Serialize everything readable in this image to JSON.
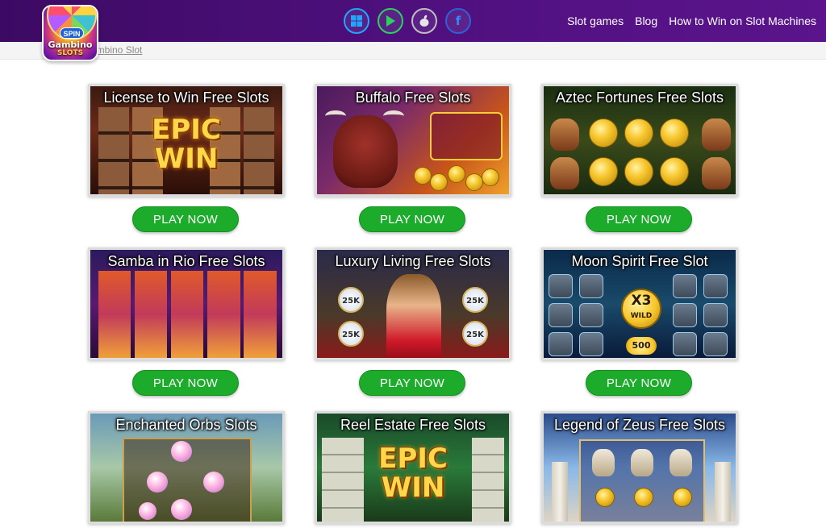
{
  "header": {
    "logo": {
      "line1": "Gambino",
      "line2": "SLOTS",
      "spin": "SPIN"
    },
    "store_icons": [
      "windows-icon",
      "google-play-icon",
      "apple-icon",
      "facebook-icon"
    ],
    "facebook_glyph": "f",
    "nav": [
      "Slot games",
      "Blog",
      "How to Win on Slot Machines"
    ]
  },
  "breadcrumb": "ambino Slot",
  "colors": {
    "header_bg": "#4f107e",
    "play_button": "#1dab2c",
    "tile_border": "#dcdcdc"
  },
  "play_label": "PLAY NOW",
  "games": [
    {
      "title": "License to Win Free Slots",
      "art_text_1": "EPIC",
      "art_text_2": "WIN"
    },
    {
      "title": "Buffalo Free Slots"
    },
    {
      "title": "Aztec Fortunes Free Slots"
    },
    {
      "title": "Samba in Rio Free Slots"
    },
    {
      "title": "Luxury Living Free Slots",
      "badge": "25K"
    },
    {
      "title": "Moon Spirit Free Slot",
      "multiplier": "X3",
      "wild": "WILD",
      "bonus": "500"
    },
    {
      "title": "Enchanted Orbs Slots"
    },
    {
      "title": "Reel Estate Free Slots",
      "art_text_1": "EPIC",
      "art_text_2": "WIN"
    },
    {
      "title": "Legend of Zeus Free Slots"
    }
  ]
}
